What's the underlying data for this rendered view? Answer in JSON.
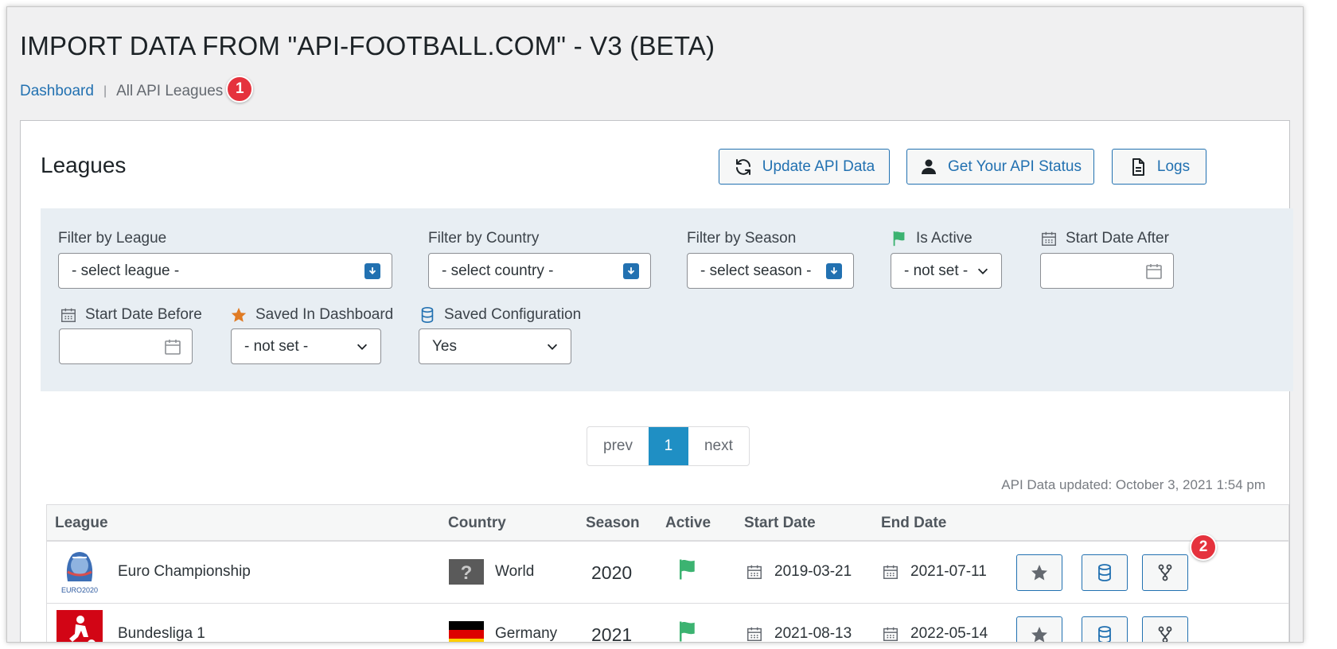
{
  "page": {
    "title": "IMPORT DATA FROM \"API-FOOTBALL.COM\" - V3 (BETA)",
    "breadcrumb": {
      "home": "Dashboard",
      "separator": "|",
      "current": "All API Leagues"
    },
    "badges": [
      "1",
      "2"
    ]
  },
  "panel": {
    "title": "Leagues",
    "buttons": {
      "update": {
        "label": "Update API Data",
        "icon": "refresh-icon"
      },
      "status": {
        "label": "Get Your API Status",
        "icon": "user-icon"
      },
      "logs": {
        "label": "Logs",
        "icon": "document-icon"
      }
    }
  },
  "filters": {
    "league": {
      "label": "Filter by League",
      "value": "- select league -"
    },
    "country": {
      "label": "Filter by Country",
      "value": "- select country -"
    },
    "season": {
      "label": "Filter by Season",
      "value": "- select season -"
    },
    "active": {
      "label": "Is Active",
      "value": "- not set -"
    },
    "start_after": {
      "label": "Start Date After",
      "value": ""
    },
    "start_before": {
      "label": "Start Date Before",
      "value": ""
    },
    "saved_dashboard": {
      "label": "Saved In Dashboard",
      "value": "- not set -"
    },
    "saved_config": {
      "label": "Saved Configuration",
      "value": "Yes"
    }
  },
  "pagination": {
    "prev": "prev",
    "current": "1",
    "next": "next"
  },
  "updated_text": "API Data updated: October 3, 2021 1:54 pm",
  "table": {
    "headers": {
      "league": "League",
      "country": "Country",
      "season": "Season",
      "active": "Active",
      "start": "Start Date",
      "end": "End Date"
    },
    "rows": [
      {
        "league": "Euro Championship",
        "country": "World",
        "season": "2020",
        "start": "2019-03-21",
        "end": "2021-07-11",
        "logo_text": "EURO2020"
      },
      {
        "league": "Bundesliga 1",
        "country": "Germany",
        "season": "2021",
        "start": "2021-08-13",
        "end": "2022-05-14"
      }
    ]
  },
  "colors": {
    "accent": "#2271b1",
    "badge": "#e5323d",
    "active_flag": "#3cb371",
    "star": "#e07b24",
    "page_bg": "#f0f0f1"
  }
}
